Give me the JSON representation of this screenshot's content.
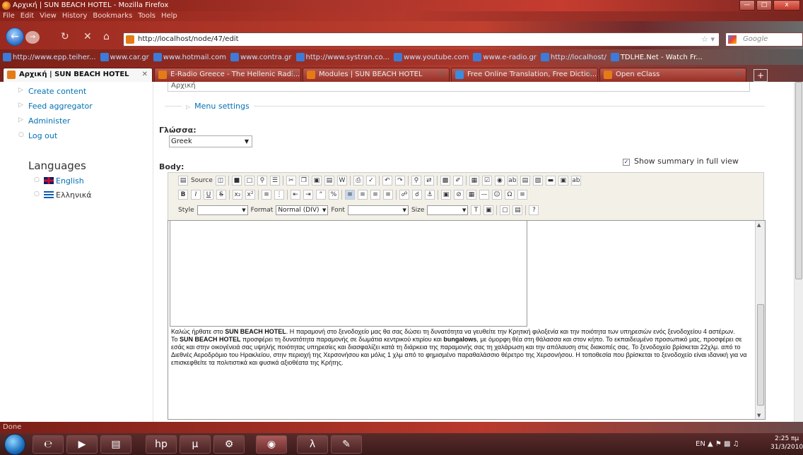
{
  "window": {
    "title": "Αρχική | SUN BEACH HOTEL - Mozilla Firefox",
    "min": "—",
    "max": "□",
    "close": "x"
  },
  "menu": [
    "File",
    "Edit",
    "View",
    "History",
    "Bookmarks",
    "Tools",
    "Help"
  ],
  "nav": {
    "url": "http://localhost/node/47/edit",
    "search_placeholder": "Google"
  },
  "bookmarks": [
    "http://www.epp.teiher...",
    "www.car.gr",
    "www.hotmail.com",
    "www.contra.gr",
    "http://www.systran.co...",
    "www.youtube.com",
    "www.e-radio.gr",
    "http://localhost/",
    "TDLHE.Net - Watch Fr..."
  ],
  "tabs": [
    {
      "label": "Αρχική | SUN BEACH HOTEL",
      "active": true
    },
    {
      "label": "E-Radio Greece - The Hellenic Radi...",
      "active": false
    },
    {
      "label": "Modules | SUN BEACH HOTEL",
      "active": false
    },
    {
      "label": "Free Online Translation, Free Dictio...",
      "active": false
    },
    {
      "label": "Open eClass",
      "active": false
    }
  ],
  "sidebar": {
    "items": [
      "Create content",
      "Feed aggregator",
      "Administer",
      "Log out"
    ],
    "languages_title": "Languages",
    "languages": [
      "English",
      "Ελληνικά"
    ]
  },
  "form": {
    "title_value": "Αρχική",
    "menu_settings": "Menu settings",
    "language_label": "Γλώσσα:",
    "language_value": "Greek",
    "summary_label": "Show summary in full view",
    "body_label": "Body:"
  },
  "toolbar": {
    "source": "Source",
    "style": "Style",
    "format": "Format",
    "format_value": "Normal (DIV)",
    "font": "Font",
    "size": "Size"
  },
  "editor": {
    "p1_a": "Καλώς ήρθατε στο ",
    "p1_b": "SUN BEACH HOTEL",
    "p1_c": ". Η παραμονή στο ξενοδοχείο μας θα σας δώσει τη δυνατότητα να γευθείτε την Κρητική φιλοξενία και την ποιότητα των υπηρεσιών ενός ξενοδοχείου 4 αστέρων.",
    "p2_a": "Το ",
    "p2_b": "SUN BEACH HOTEL",
    "p2_c": " προσφέρει τη δυνατότητα παραμονής σε δωμάτια κεντρικού κτιρίου και ",
    "p2_d": "bungalows",
    "p2_e": ", με όμορφη θέα στη θάλασσα και στον κήπο. Το εκπαιδευμένο προσωπικό μας, προσφέρει σε εσάς και στην οικογένειά σας υψηλής ποιότητας υπηρεσίες και διασφαλίζει κατά τη διάρκεια της παραμονής σας τη χαλάρωση και την απόλαυση στις διακοπές σας. Το ξενοδοχείο βρίσκεται 22χλμ. από το Διεθνές Αεροδρόμιο του Ηρακλείου, στην περιοχή της Χερσονήσου και μόλις 1 χλμ από το φημισμένο παραθαλάσσιο θέρετρο της Χερσονήσου. Η τοποθεσία που βρίσκεται το ξενοδοχείο είναι ιδανική για να επισκεφθείτε τα πολιτιστικά και φυσικά αξιοθέατα της Κρήτης."
  },
  "status": "Done",
  "tray": {
    "lang": "EN",
    "time": "2:25 πμ",
    "date": "31/3/2010"
  },
  "colors": {
    "link": "#0071b3",
    "chrome": "#b4382c"
  }
}
